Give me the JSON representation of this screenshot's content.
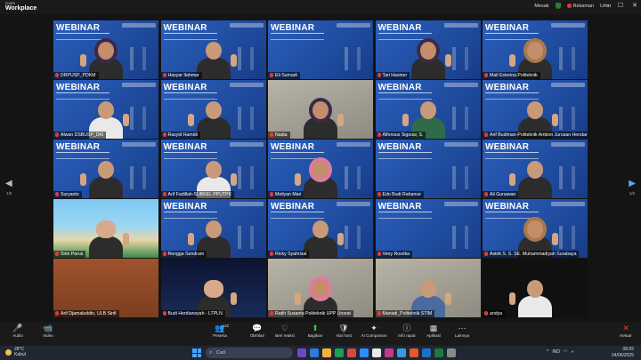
{
  "app": {
    "brand_top": "zoom",
    "brand_name": "Workplace"
  },
  "topbar": {
    "recipient": "Mesak",
    "recording_label": "Rekaman",
    "view_label": "Lihat"
  },
  "window_controls": {
    "minimize": "–",
    "maximize": "☐",
    "close": "✕"
  },
  "tiles": [
    {
      "name": "DRPUSP_PDKM",
      "style": "webinar",
      "person": "hijab",
      "active": true
    },
    {
      "name": "Hasyar Ilahmar",
      "style": "webinar",
      "person": "plain"
    },
    {
      "name": "Eli Sumadi",
      "style": "webinar",
      "person": "none"
    },
    {
      "name": "Tari Hasiner",
      "style": "webinar",
      "person": "hijab"
    },
    {
      "name": "Mail Esterina Politeknik",
      "style": "webinar",
      "person": "hijab brown"
    },
    {
      "name": "Alwan DSBUSP_DKI",
      "style": "webinar",
      "person": "white"
    },
    {
      "name": "Rasyid Hamidi",
      "style": "webinar",
      "person": "plain"
    },
    {
      "name": "Nadia",
      "style": "real",
      "person": "hijab"
    },
    {
      "name": "Alfonsus Sigouw, S.",
      "style": "webinar",
      "person": "green"
    },
    {
      "name": "Arif Budiman-Politeknik Ambon Jurusan Hendarto",
      "style": "webinar",
      "person": "plain"
    },
    {
      "name": "Suryanto",
      "style": "webinar",
      "person": "plain"
    },
    {
      "name": "Arif Fadillah-SUBKEL PPUTPK",
      "style": "webinar",
      "person": "white"
    },
    {
      "name": "Meilyan Mari",
      "style": "webinar",
      "person": "hijab pink"
    },
    {
      "name": "Edo Budi Rahanse",
      "style": "webinar",
      "person": "none"
    },
    {
      "name": "Ali Gunawan",
      "style": "webinar",
      "person": "plain"
    },
    {
      "name": "Sirin Parus",
      "style": "beach",
      "person": "avatar"
    },
    {
      "name": "Rengga Sendram",
      "style": "webinar",
      "person": "plain"
    },
    {
      "name": "Ricky Syahrizal",
      "style": "webinar",
      "person": "plain"
    },
    {
      "name": "Veny Rosrika",
      "style": "webinar",
      "person": "none"
    },
    {
      "name": "Astrik S. S. SE. Muhammadiyah Surabaya",
      "style": "webinar",
      "person": "hijab brown"
    },
    {
      "name": "Arif Djamaluddin, ULB Sinfi",
      "style": "room",
      "person": "none"
    },
    {
      "name": "Budi Herdiansyah - LTPLN",
      "style": "dark",
      "person": "avatar"
    },
    {
      "name": "Ratih Susanta Politeknik UPP Unsrat",
      "style": "real",
      "person": "hijab pink"
    },
    {
      "name": "Maniati_Politeknik STIM",
      "style": "real",
      "person": "blue"
    },
    {
      "name": "andya",
      "style": "black",
      "person": "white"
    }
  ],
  "tile_texts": {
    "webinar": "WEBINAR"
  },
  "pagination": {
    "left": "1/5",
    "right": "1/5"
  },
  "controls": [
    {
      "id": "audio",
      "label": "Audio",
      "icon": "🎤",
      "state": "red"
    },
    {
      "id": "video",
      "label": "Video",
      "icon": "📹",
      "state": "red"
    },
    {
      "id": "participants",
      "label": "Peserta",
      "icon": "👥",
      "badge": "122"
    },
    {
      "id": "chat",
      "label": "Obrolan",
      "icon": "💬"
    },
    {
      "id": "reactions",
      "label": "Beri reaksi",
      "icon": "♡"
    },
    {
      "id": "share",
      "label": "Bagikan",
      "icon": "⬆",
      "state": "green"
    },
    {
      "id": "host_tools",
      "label": "Alat host",
      "icon": "🛡"
    },
    {
      "id": "ai_companion",
      "label": "AI Companion",
      "icon": "✦"
    },
    {
      "id": "meeting_info",
      "label": "Info rapat",
      "icon": "ⓘ"
    },
    {
      "id": "apps",
      "label": "Aplikasi",
      "icon": "▦"
    },
    {
      "id": "more",
      "label": "Lainnya",
      "icon": "⋯"
    },
    {
      "id": "leave",
      "label": "Keluar",
      "icon": "✕",
      "state": "red"
    }
  ],
  "taskbar": {
    "weather_temp": "28°C",
    "weather_desc": "Kabut",
    "search_placeholder": "Cari",
    "tray_lang": "IND",
    "time": "08.55",
    "date": "04/06/2025"
  },
  "icons": {
    "mic_off": "mic-off-icon",
    "nav_prev": "chevron-left-icon",
    "nav_next": "chevron-right-icon"
  },
  "colors": {
    "webinar_blue": "#2451a8",
    "active_outline": "#34c759",
    "muted_red": "#e53935"
  }
}
